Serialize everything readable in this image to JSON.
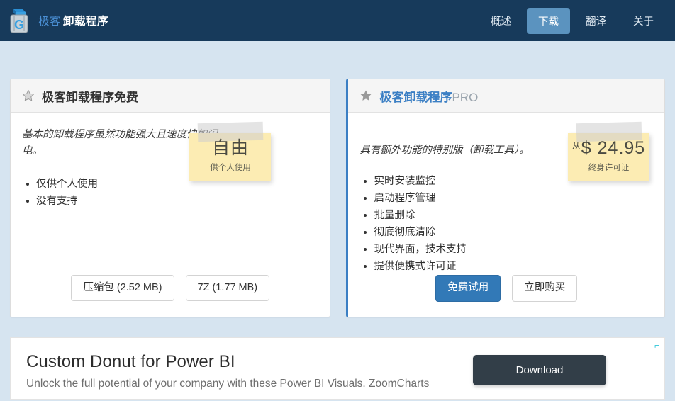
{
  "navbar": {
    "logo_icon": "recycle-bin-g-icon",
    "brand_prefix": "极客",
    "brand_name": "卸载程序",
    "links": [
      {
        "label": "概述",
        "active": false
      },
      {
        "label": "下载",
        "active": true
      },
      {
        "label": "翻译",
        "active": false
      },
      {
        "label": "关于",
        "active": false
      }
    ]
  },
  "free_card": {
    "icon": "star-outline-icon",
    "title": "极客卸载程序免费",
    "description": "基本的卸载程序虽然功能强大且速度快如闪电。",
    "features": [
      "仅供个人使用",
      "没有支持"
    ],
    "sticky": {
      "main": "自由",
      "sub": "供个人使用"
    },
    "buttons": [
      {
        "label": "压缩包 (2.52 MB)",
        "style": "outline"
      },
      {
        "label": "7Z (1.77 MB)",
        "style": "outline"
      }
    ]
  },
  "pro_card": {
    "icon": "star-filled-icon",
    "title": "极客卸载程序",
    "title_suffix": "PRO",
    "description": "具有额外功能的特别版（卸载工具）。",
    "features": [
      "实时安装监控",
      "启动程序管理",
      "批量删除",
      "彻底彻底清除",
      "现代界面，技术支持",
      "提供便携式许可证"
    ],
    "sticky": {
      "from": "从",
      "main": "$ 24.95",
      "sub": "终身许可证"
    },
    "buttons": [
      {
        "label": "免费试用",
        "style": "primary"
      },
      {
        "label": "立即购买",
        "style": "outline"
      }
    ]
  },
  "ad": {
    "title": "Custom Donut for Power BI",
    "subtitle": "Unlock the full potential of your company with these Power BI Visuals. ZoomCharts",
    "button_label": "Download",
    "close_icon": "ad-close-icon",
    "close_glyph": "⌐"
  },
  "colors": {
    "navbar_bg": "#173A5B",
    "active_tab_bg": "#5b93bf",
    "page_bg": "#d6e4f0",
    "accent_blue": "#3b7fc4",
    "primary_button": "#3279b7",
    "sticky_yellow": "#fcecb3",
    "ad_button_bg": "#323e48"
  }
}
